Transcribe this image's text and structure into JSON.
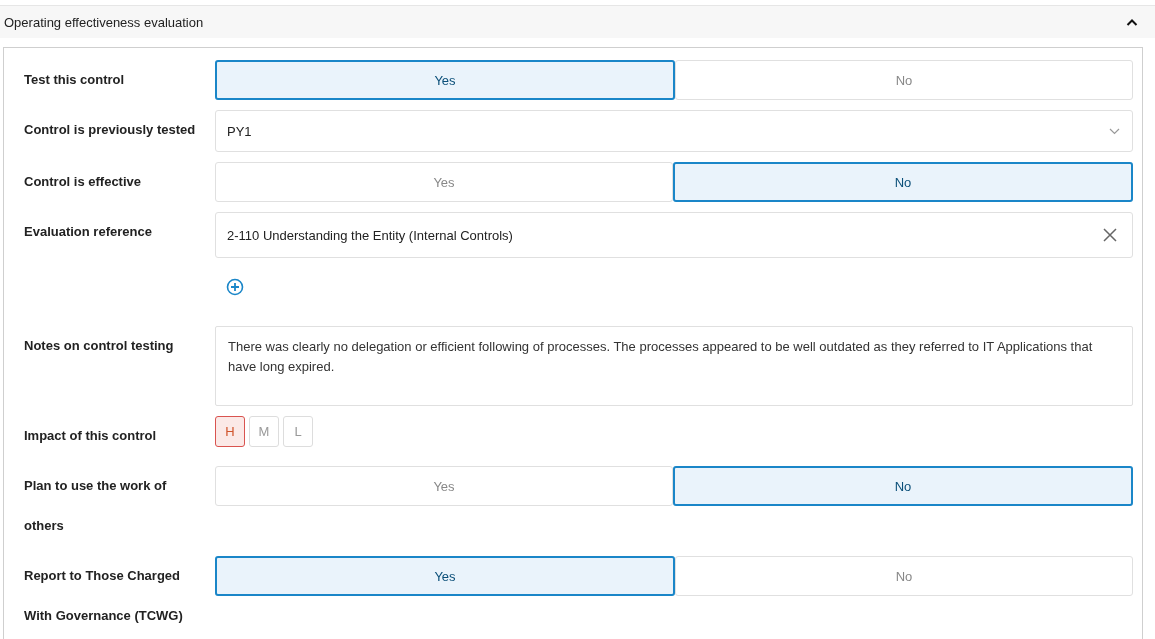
{
  "section": {
    "title": "Operating effectiveness evaluation",
    "expanded": true
  },
  "fields": [
    {
      "kind": "toggle",
      "label": "Test this control",
      "options": [
        {
          "label": "Yes",
          "selected": true
        },
        {
          "label": "No",
          "selected": false
        }
      ]
    },
    {
      "kind": "select",
      "label": "Control is previously tested",
      "value": "PY1"
    },
    {
      "kind": "toggle",
      "label": "Control is effective",
      "options": [
        {
          "label": "Yes",
          "selected": false
        },
        {
          "label": "No",
          "selected": true
        }
      ]
    },
    {
      "kind": "reference",
      "label": "Evaluation reference",
      "value": "2-110 Understanding the Entity (Internal Controls)"
    },
    {
      "kind": "notes",
      "label": "Notes on control testing",
      "value": "There was clearly no delegation or efficient following of processes. The processes appeared to be well outdated as they referred to IT Applications that have long expired."
    },
    {
      "kind": "impact",
      "label": "Impact of this control",
      "options": [
        {
          "label": "H",
          "selected": true
        },
        {
          "label": "M",
          "selected": false
        },
        {
          "label": "L",
          "selected": false
        }
      ]
    },
    {
      "kind": "toggle",
      "label": "Plan to use the work of others",
      "options": [
        {
          "label": "Yes",
          "selected": false
        },
        {
          "label": "No",
          "selected": true
        }
      ]
    },
    {
      "kind": "toggle",
      "label": "Report to Those Charged With Governance (TCWG)",
      "options": [
        {
          "label": "Yes",
          "selected": true
        },
        {
          "label": "No",
          "selected": false
        }
      ]
    }
  ]
}
